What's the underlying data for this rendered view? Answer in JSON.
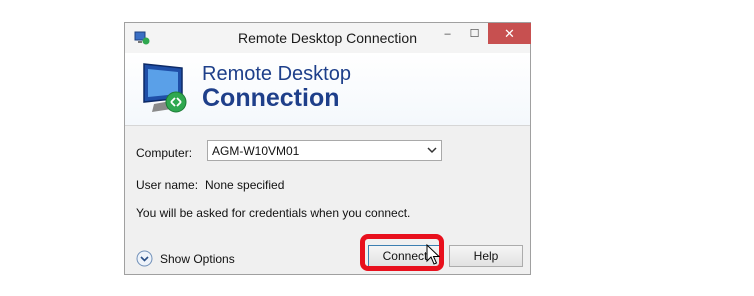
{
  "window": {
    "title": "Remote Desktop Connection",
    "controls": {
      "minimize": "–",
      "maximize": "☐",
      "close": "✕"
    }
  },
  "banner": {
    "line1": "Remote Desktop",
    "line2": "Connection",
    "icon": "monitor-remote-icon"
  },
  "form": {
    "computer_label": "Computer:",
    "computer_value": "AGM-W10VM01",
    "user_label": "User name:",
    "user_value": "None specified",
    "note": "You will be asked for credentials when you connect."
  },
  "footer": {
    "show_options_label": "Show Options",
    "connect_label": "Connect",
    "help_label": "Help"
  },
  "colors": {
    "accent": "#1e3f8a",
    "close_button": "#c75050",
    "highlight": "#e8101d"
  }
}
